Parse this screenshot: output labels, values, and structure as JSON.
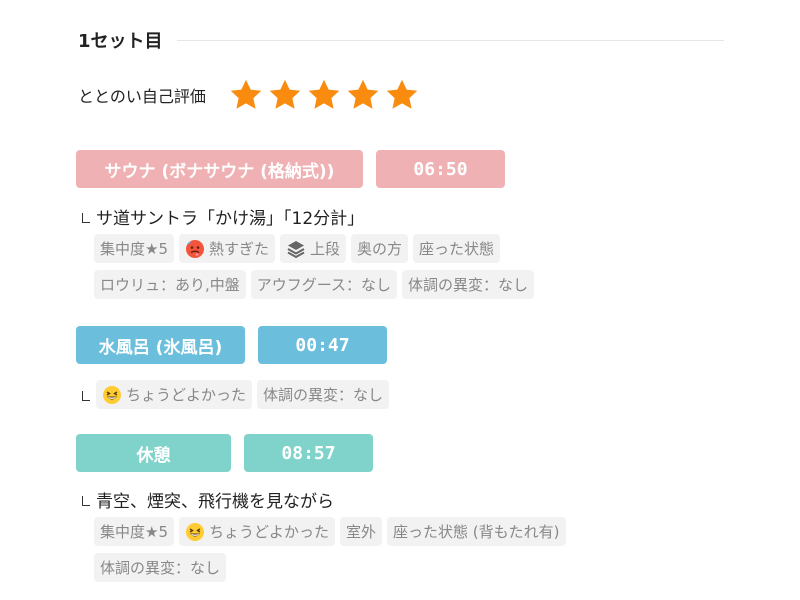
{
  "set": {
    "title": "1セット目",
    "evaluation_label": "ととのい自己評価",
    "rating": 5,
    "rating_max": 5,
    "star_color": "#f98c0f"
  },
  "sauna": {
    "label": "サウナ (ボナサウナ (格納式))",
    "time": "06:50",
    "color": "#efb1b3",
    "memo": "サ道サントラ「かけ湯」「12分計」",
    "tags_row1": [
      "集中度★5",
      "熱すぎた",
      "上段",
      "奥の方",
      "座った状態"
    ],
    "tags_row2": [
      "ロウリュ：あり,中盤",
      "アウフグース：なし",
      "体調の異変：なし"
    ]
  },
  "water": {
    "label": "水風呂 (氷風呂)",
    "time": "00:47",
    "color": "#6bbfdd",
    "tags": [
      "ちょうどよかった",
      "体調の異変：なし"
    ]
  },
  "rest": {
    "label": "休憩",
    "time": "08:57",
    "color": "#7fd3ca",
    "memo": "青空、煙突、飛行機を見ながら",
    "tags_row1": [
      "集中度★5",
      "ちょうどよかった",
      "室外",
      "座った状態 (背もたれ有)"
    ],
    "tags_row2": [
      "体調の異変：なし"
    ]
  },
  "icons": {
    "hot": "hot-face-emoji",
    "layers": "layers-icon",
    "grin": "grinning-squinting-face-emoji"
  }
}
